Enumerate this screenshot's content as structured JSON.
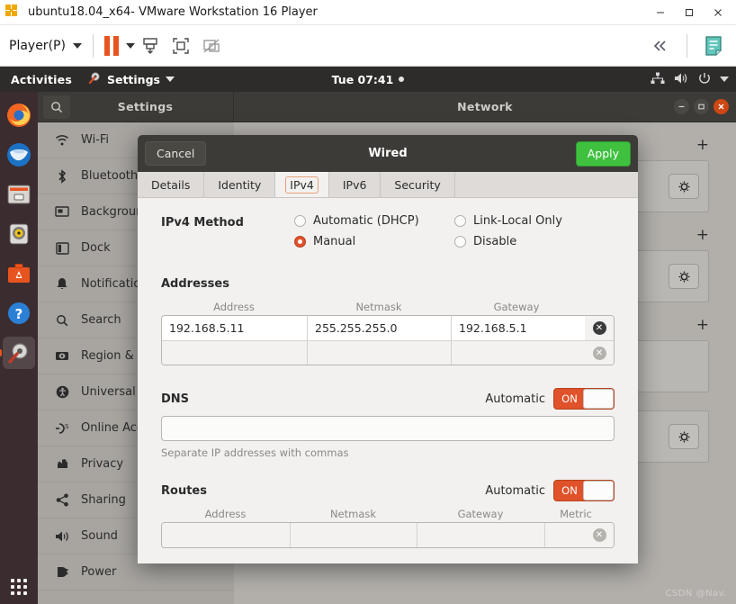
{
  "vmware": {
    "title": "ubuntu18.04_x64- VMware Workstation 16 Player",
    "logo_icon": "vmware-logo-icon",
    "window_controls": [
      {
        "name": "minimize-button",
        "glyph": "–"
      },
      {
        "name": "maximize-button",
        "glyph": "▫"
      },
      {
        "name": "close-button",
        "glyph": "✕"
      }
    ],
    "toolbar": {
      "player_menu_label": "Player(P)",
      "pause_icon": "pause-icon",
      "pause_dropdown_icon": "chevron-down-icon",
      "send_ctrl_alt_del_icon": "send-key-icon",
      "fullscreen_icon": "fullscreen-icon",
      "unity_icon": "unity-mode-icon",
      "collapse_icon": "collapse-toolbar-icon",
      "notes_icon": "notes-icon"
    }
  },
  "gnome_topbar": {
    "activities_label": "Activities",
    "app_menu_label": "Settings",
    "app_menu_icon": "settings-app-icon",
    "app_menu_caret_icon": "chevron-down-icon",
    "clock": "Tue 07:41",
    "clock_dot_icon": "notification-dot-icon",
    "tray": [
      {
        "name": "network-tray-icon",
        "icon": "network-icon"
      },
      {
        "name": "volume-tray-icon",
        "icon": "volume-icon"
      },
      {
        "name": "power-tray-icon",
        "icon": "power-icon"
      },
      {
        "name": "system-menu-caret-icon",
        "icon": "chevron-down-icon"
      }
    ]
  },
  "dock": {
    "items": [
      {
        "name": "dock-item-firefox",
        "icon": "firefox-icon"
      },
      {
        "name": "dock-item-thunderbird",
        "icon": "thunderbird-icon"
      },
      {
        "name": "dock-item-files",
        "icon": "files-icon"
      },
      {
        "name": "dock-item-rhythmbox",
        "icon": "rhythmbox-icon"
      },
      {
        "name": "dock-item-software",
        "icon": "ubuntu-software-icon"
      },
      {
        "name": "dock-item-help",
        "icon": "help-icon"
      },
      {
        "name": "dock-item-settings",
        "icon": "settings-icon",
        "active": true
      }
    ],
    "show_apps_icon": "show-applications-icon"
  },
  "settings_window": {
    "search_icon": "search-icon",
    "sidebar_title": "Settings",
    "panel_title": "Network",
    "window_controls": [
      {
        "name": "minimize-button",
        "glyph": "–"
      },
      {
        "name": "maximize-button",
        "glyph": "▫"
      },
      {
        "name": "close-button",
        "glyph": "✕"
      }
    ],
    "sidebar_items": [
      {
        "label": "Wi-Fi",
        "icon": "wifi-icon",
        "name": "sidebar-item-wifi"
      },
      {
        "label": "Bluetooth",
        "icon": "bluetooth-icon",
        "name": "sidebar-item-bluetooth"
      },
      {
        "label": "Background",
        "icon": "background-icon",
        "name": "sidebar-item-background"
      },
      {
        "label": "Dock",
        "icon": "dock-icon",
        "name": "sidebar-item-dock"
      },
      {
        "label": "Notifications",
        "icon": "bell-icon",
        "name": "sidebar-item-notifications"
      },
      {
        "label": "Search",
        "icon": "search-icon",
        "name": "sidebar-item-search"
      },
      {
        "label": "Region & Language",
        "icon": "region-icon",
        "name": "sidebar-item-region-language"
      },
      {
        "label": "Universal Access",
        "icon": "accessibility-icon",
        "name": "sidebar-item-universal-access"
      },
      {
        "label": "Online Accounts",
        "icon": "online-accounts-icon",
        "name": "sidebar-item-online-accounts"
      },
      {
        "label": "Privacy",
        "icon": "privacy-icon",
        "name": "sidebar-item-privacy"
      },
      {
        "label": "Sharing",
        "icon": "sharing-icon",
        "name": "sidebar-item-sharing"
      },
      {
        "label": "Sound",
        "icon": "sound-icon",
        "name": "sidebar-item-sound"
      },
      {
        "label": "Power",
        "icon": "power-plug-icon",
        "name": "sidebar-item-power"
      }
    ],
    "network_sections": [
      {
        "add_label": "+",
        "has_gear": true
      },
      {
        "add_label": "+",
        "has_gear": true
      },
      {
        "add_label": "+",
        "has_gear": false
      },
      {
        "add_label": "",
        "has_gear": true
      }
    ],
    "watermark": "CSDN @Nav."
  },
  "dialog": {
    "cancel_label": "Cancel",
    "title": "Wired",
    "apply_label": "Apply",
    "tabs": [
      {
        "label": "Details",
        "selected": false
      },
      {
        "label": "Identity",
        "selected": false
      },
      {
        "label": "IPv4",
        "selected": true
      },
      {
        "label": "IPv6",
        "selected": false
      },
      {
        "label": "Security",
        "selected": false
      }
    ],
    "ipv4_method": {
      "label": "IPv4 Method",
      "options": [
        {
          "label": "Automatic (DHCP)",
          "selected": false
        },
        {
          "label": "Link-Local Only",
          "selected": false
        },
        {
          "label": "Manual",
          "selected": true
        },
        {
          "label": "Disable",
          "selected": false
        }
      ]
    },
    "addresses": {
      "title": "Addresses",
      "columns": [
        "Address",
        "Netmask",
        "Gateway"
      ],
      "rows": [
        [
          "192.168.5.11",
          "255.255.255.0",
          "192.168.5.1"
        ],
        [
          "",
          "",
          ""
        ]
      ],
      "delete_icon": "delete-row-icon"
    },
    "dns": {
      "title": "DNS",
      "automatic_label": "Automatic",
      "toggle_state": "ON",
      "value": "",
      "hint": "Separate IP addresses with commas"
    },
    "routes": {
      "title": "Routes",
      "automatic_label": "Automatic",
      "toggle_state": "ON",
      "columns": [
        "Address",
        "Netmask",
        "Gateway",
        "Metric"
      ],
      "rows": [
        [
          "",
          "",
          "",
          ""
        ]
      ],
      "delete_icon": "delete-row-icon"
    }
  },
  "colors": {
    "ubuntu_orange": "#e0522a",
    "apply_green": "#3fc13f",
    "topbar_dark": "#2e2c2b",
    "headerbar_dark": "#3c3b37",
    "dialog_bg": "#f2f1f0"
  }
}
